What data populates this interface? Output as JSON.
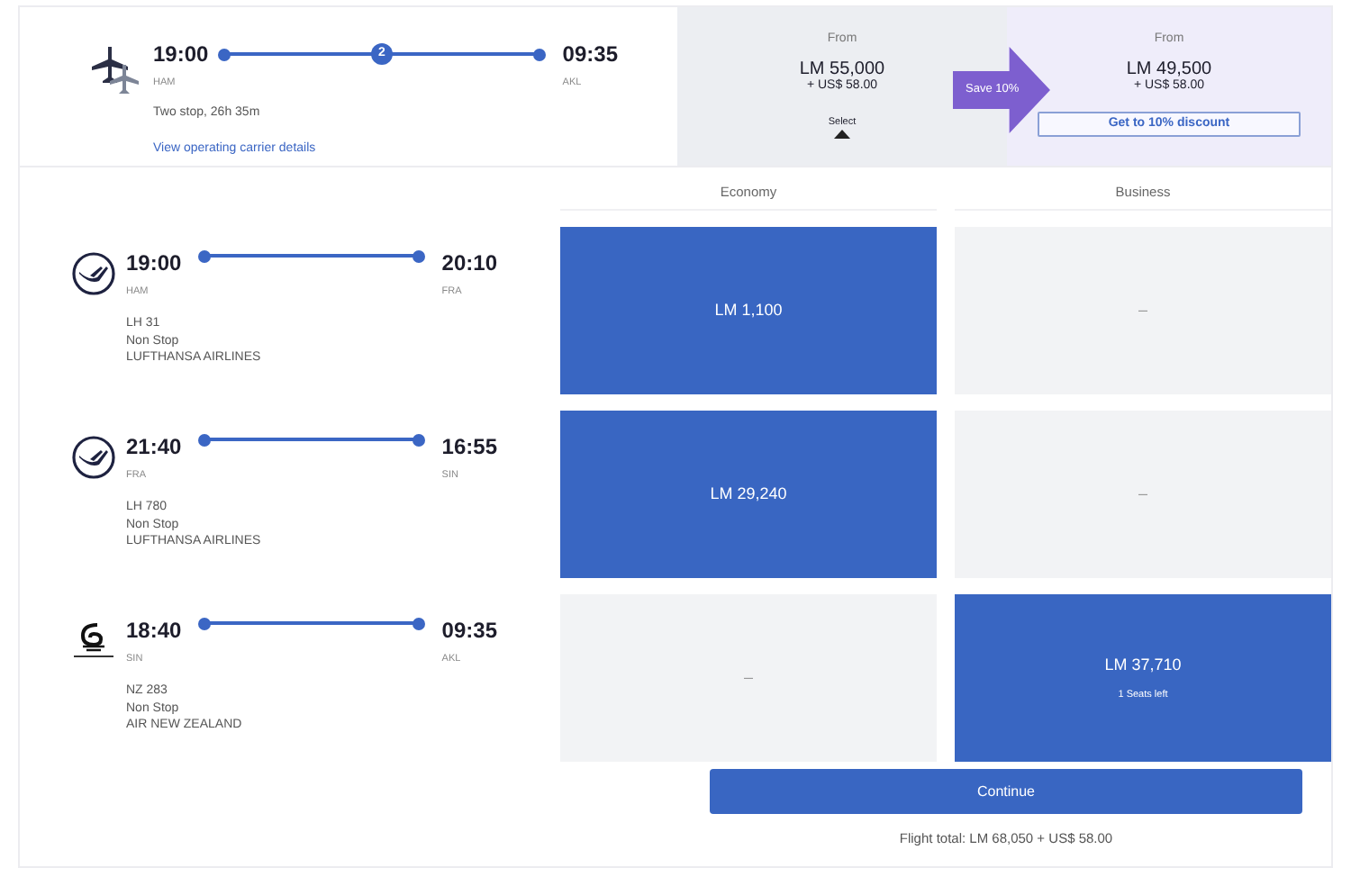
{
  "summary": {
    "departure_time": "19:00",
    "departure_airport": "HAM",
    "stops_badge": "2",
    "arrival_time": "09:35",
    "arrival_airport": "AKL",
    "duration": "Two stop, 26h 35m",
    "link": "View operating carrier details"
  },
  "fares": [
    {
      "kind": "standard",
      "label": "From",
      "price": "LM 55,000",
      "surcharge": "+ US$ 58.00",
      "select_label": "Select",
      "selected": true
    },
    {
      "kind": "discount",
      "label": "From",
      "price": "LM 49,500",
      "surcharge": "+ US$ 58.00",
      "button": "Get to 10% discount",
      "selected": false
    }
  ],
  "save_badge": "Save 10%",
  "cabins": [
    "Economy",
    "Business"
  ],
  "segments": [
    {
      "kind": "crane",
      "departure_time": "19:00",
      "departure_airport": "HAM",
      "arrival_time": "20:10",
      "arrival_airport": "FRA",
      "flight": "LH 31",
      "stops": "Non Stop",
      "airline": "LUFTHANSA AIRLINES",
      "options": [
        {
          "text": "LM 1,100",
          "selected": true
        },
        {
          "text": "–",
          "selected": false
        }
      ]
    },
    {
      "kind": "crane",
      "departure_time": "21:40",
      "departure_airport": "FRA",
      "arrival_time": "16:55",
      "arrival_airport": "SIN",
      "flight": "LH 780",
      "stops": "Non Stop",
      "airline": "LUFTHANSA AIRLINES",
      "options": [
        {
          "text": "LM 29,240",
          "selected": true
        },
        {
          "text": "–",
          "selected": false
        }
      ]
    },
    {
      "kind": "fern",
      "departure_time": "18:40",
      "departure_airport": "SIN",
      "arrival_time": "09:35",
      "arrival_airport": "AKL",
      "flight": "NZ 283",
      "stops": "Non Stop",
      "airline": "AIR NEW ZEALAND",
      "options": [
        {
          "text": "–",
          "selected": false
        },
        {
          "text": "LM 37,710",
          "note": "1 Seats left",
          "selected": true
        }
      ]
    }
  ],
  "continue_button": "Continue",
  "total": "Flight total: LM 68,050 + US$ 58.00"
}
